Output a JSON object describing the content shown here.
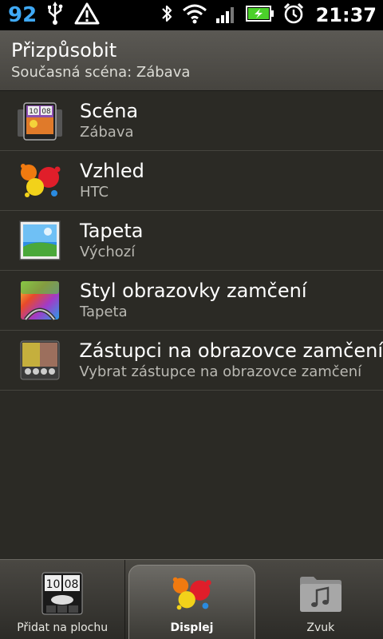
{
  "status_bar": {
    "notification_count": "92",
    "time": "21:37"
  },
  "header": {
    "title": "Přizpůsobit",
    "subtitle": "Současná scéna: Zábava"
  },
  "items": [
    {
      "label": "Scéna",
      "sub": "Zábava",
      "icon": "scene-icon"
    },
    {
      "label": "Vzhled",
      "sub": "HTC",
      "icon": "skin-icon"
    },
    {
      "label": "Tapeta",
      "sub": "Výchozí",
      "icon": "wallpaper-icon"
    },
    {
      "label": "Styl obrazovky zamčení",
      "sub": "Tapeta",
      "icon": "lockscreen-style-icon"
    },
    {
      "label": "Zástupci na obrazovce zamčení",
      "sub": "Vybrat zástupce na obrazovce zamčení",
      "icon": "lockscreen-shortcuts-icon"
    }
  ],
  "tabs": [
    {
      "label": "Přidat na plochu",
      "icon": "add-to-home-icon"
    },
    {
      "label": "Displej",
      "icon": "display-icon",
      "active": true
    },
    {
      "label": "Zvuk",
      "icon": "sound-icon"
    }
  ],
  "colors": {
    "background": "#2b2a25",
    "status_blue": "#3fa9f5",
    "battery_green": "#4bd12a"
  }
}
